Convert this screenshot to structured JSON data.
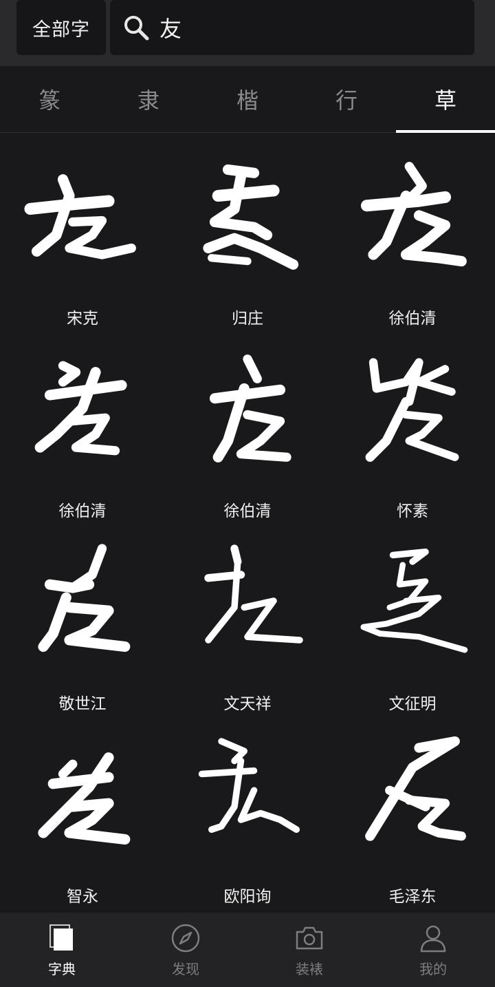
{
  "header": {
    "scope_label": "全部字",
    "search_value": "友"
  },
  "tabs": [
    {
      "label": "篆",
      "active": false
    },
    {
      "label": "隶",
      "active": false
    },
    {
      "label": "楷",
      "active": false
    },
    {
      "label": "行",
      "active": false
    },
    {
      "label": "草",
      "active": true
    }
  ],
  "grid": {
    "items": [
      {
        "calligrapher": "宋克",
        "glyph": "友"
      },
      {
        "calligrapher": "归庄",
        "glyph": "友"
      },
      {
        "calligrapher": "徐伯清",
        "glyph": "友"
      },
      {
        "calligrapher": "徐伯清",
        "glyph": "友"
      },
      {
        "calligrapher": "徐伯清",
        "glyph": "友"
      },
      {
        "calligrapher": "怀素",
        "glyph": "友"
      },
      {
        "calligrapher": "敬世江",
        "glyph": "友"
      },
      {
        "calligrapher": "文天祥",
        "glyph": "友"
      },
      {
        "calligrapher": "文征明",
        "glyph": "友"
      },
      {
        "calligrapher": "智永",
        "glyph": "友"
      },
      {
        "calligrapher": "欧阳询",
        "glyph": "友"
      },
      {
        "calligrapher": "毛泽东",
        "glyph": "友"
      }
    ]
  },
  "bottom_nav": [
    {
      "label": "字典",
      "icon": "dictionary-icon",
      "active": true
    },
    {
      "label": "发现",
      "icon": "compass-icon",
      "active": false
    },
    {
      "label": "装裱",
      "icon": "camera-icon",
      "active": false
    },
    {
      "label": "我的",
      "icon": "profile-icon",
      "active": false
    }
  ],
  "colors": {
    "background": "#19191b",
    "header": "#2a2a2c",
    "active": "#ffffff",
    "inactive": "#8a8a8f"
  }
}
